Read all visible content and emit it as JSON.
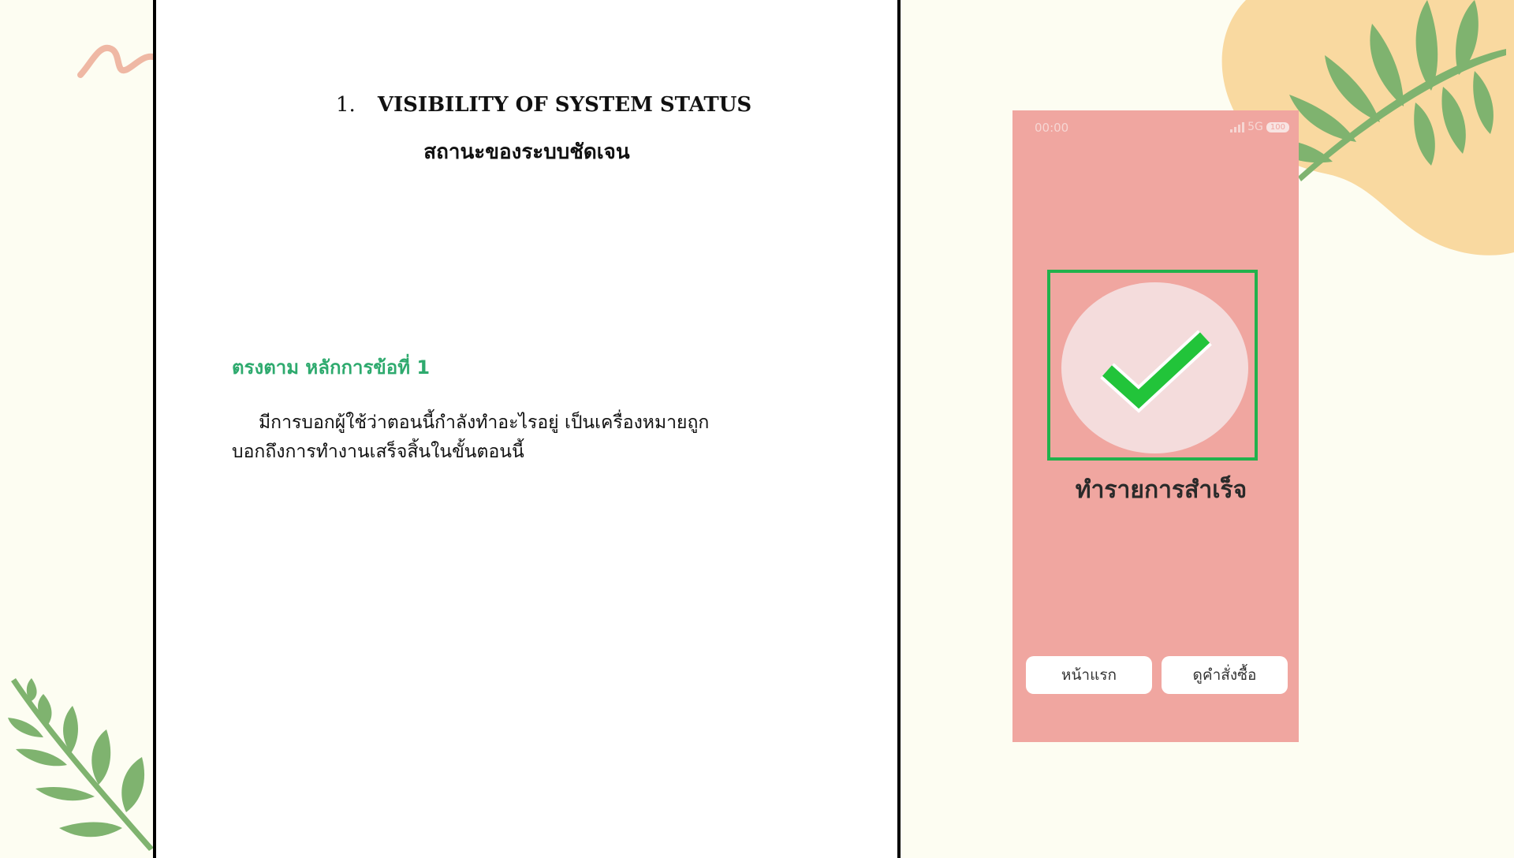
{
  "slide": {
    "number": "1.",
    "heading": "VISIBILITY OF SYSTEM STATUS",
    "subheading": "สถานะของระบบชัดเจน",
    "principle": "ตรงตาม หลักการข้อที่ 1",
    "body_line1": "มีการบอกผู้ใช้ว่าตอนนี้กำลังทำอะไรอยู่ เป็นเครื่องหมายถูก",
    "body_line2": "บอกถึงการทำงานเสร็จสิ้นในขั้นตอนนี้"
  },
  "phone": {
    "time": "00:00",
    "network": "5G",
    "battery": "100",
    "success_label": "ทำรายการสำเร็จ",
    "home_button": "หน้าแรก",
    "orders_button": "ดูคำสั่งซื้อ",
    "icons": {
      "check": "check-icon",
      "signal": "signal-icon",
      "battery": "battery-icon"
    }
  },
  "colors": {
    "background": "#fdfdf2",
    "phone_bg": "#f0a6a0",
    "check_green": "#22b14c",
    "principle_green": "#2eaa6e",
    "leaf_green": "#7fb36f",
    "blob_peach": "#f9d9a0",
    "squiggle": "#efb8a4"
  }
}
